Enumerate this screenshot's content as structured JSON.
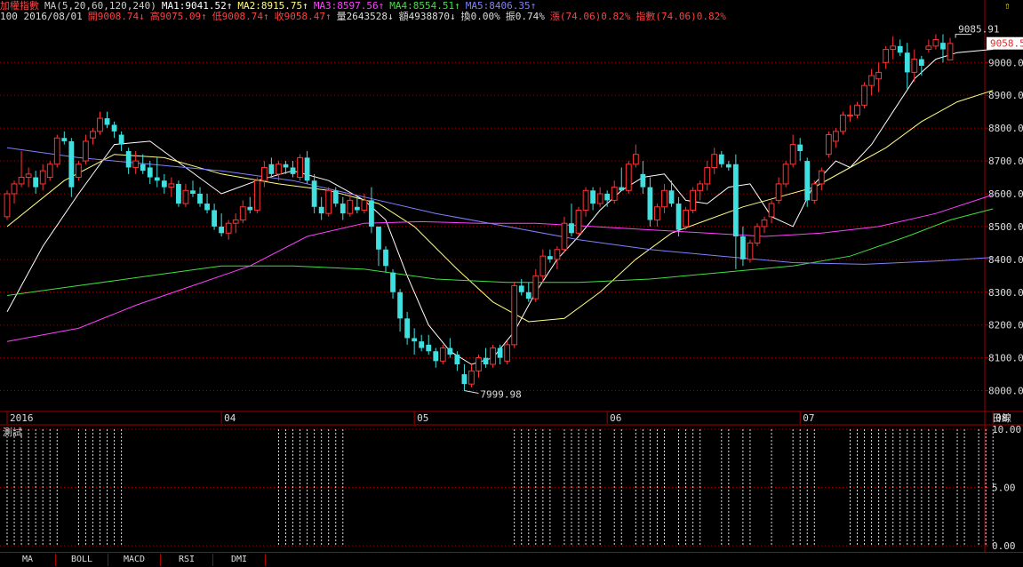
{
  "header": {
    "title": "加權指數",
    "ma_params": "MA(5,20,60,120,240)",
    "ma1": "MA1:9041.52↑",
    "ma2": "MA2:8915.75↑",
    "ma3": "MA3:8597.56↑",
    "ma4": "MA4:8554.51↑",
    "ma5": "MA5:8406.35↑",
    "info_prefix": "100 2016/08/01",
    "open": "開9008.74↓",
    "high": "高9075.09↑",
    "low": "低9008.74↑",
    "close": "收9058.47↑",
    "volume": "量2643528↓",
    "amount": "額4938870↓",
    "turnover": "換0.00%",
    "amplitude": "振0.74%",
    "change": "漲(74.06)0.82%",
    "index_change": "指數(74.06)0.82%"
  },
  "corner_icon": "up-arrow-icon",
  "colors": {
    "up": "#ff3333",
    "down": "#40e0e0",
    "ma1": "#ffffff",
    "ma2": "#ffff80",
    "ma3": "#ff40ff",
    "ma4": "#40e040",
    "ma5": "#8080ff",
    "grid": "#a00000",
    "price_tag": "#ff2020"
  },
  "chart_data": {
    "type": "candlestick",
    "ylim": [
      7950,
      9120
    ],
    "y_ticks": [
      "9000.0",
      "8900.0",
      "8800.0",
      "8700.0",
      "8600.0",
      "8500.0",
      "8400.0",
      "8300.0",
      "8200.0",
      "8100.0",
      "8000.0"
    ],
    "y_tick_values": [
      9000,
      8900,
      8800,
      8700,
      8600,
      8500,
      8400,
      8300,
      8200,
      8100,
      8000
    ],
    "x_labels": [
      {
        "label": "2016",
        "index": 0
      },
      {
        "label": "04",
        "index": 30
      },
      {
        "label": "05",
        "index": 57
      },
      {
        "label": "06",
        "index": 84
      },
      {
        "label": "07",
        "index": 111
      },
      {
        "label": "08",
        "index": 138
      }
    ],
    "date_axis_label": "日線",
    "last_price": "9058.5",
    "max_label": "9085.91",
    "max_index": 135,
    "max_value": 9085.91,
    "min_label": "7999.98",
    "min_index": 64,
    "min_value": 7999.98,
    "candles": [
      [
        8530,
        8610,
        8520,
        8600
      ],
      [
        8600,
        8640,
        8570,
        8630
      ],
      [
        8630,
        8730,
        8620,
        8650
      ],
      [
        8650,
        8680,
        8620,
        8660
      ],
      [
        8650,
        8670,
        8600,
        8620
      ],
      [
        8630,
        8690,
        8610,
        8670
      ],
      [
        8650,
        8700,
        8640,
        8690
      ],
      [
        8690,
        8780,
        8680,
        8770
      ],
      [
        8770,
        8790,
        8750,
        8760
      ],
      [
        8760,
        8770,
        8590,
        8620
      ],
      [
        8650,
        8700,
        8640,
        8690
      ],
      [
        8700,
        8780,
        8690,
        8760
      ],
      [
        8770,
        8800,
        8750,
        8790
      ],
      [
        8790,
        8850,
        8780,
        8830
      ],
      [
        8830,
        8850,
        8800,
        8810
      ],
      [
        8810,
        8820,
        8770,
        8790
      ],
      [
        8780,
        8790,
        8730,
        8750
      ],
      [
        8730,
        8740,
        8660,
        8680
      ],
      [
        8680,
        8730,
        8660,
        8700
      ],
      [
        8690,
        8720,
        8660,
        8670
      ],
      [
        8680,
        8700,
        8630,
        8650
      ],
      [
        8650,
        8710,
        8620,
        8640
      ],
      [
        8640,
        8660,
        8600,
        8620
      ],
      [
        8620,
        8650,
        8590,
        8630
      ],
      [
        8630,
        8640,
        8560,
        8570
      ],
      [
        8570,
        8630,
        8560,
        8610
      ],
      [
        8610,
        8640,
        8590,
        8600
      ],
      [
        8600,
        8620,
        8560,
        8570
      ],
      [
        8570,
        8600,
        8540,
        8550
      ],
      [
        8550,
        8570,
        8490,
        8500
      ],
      [
        8500,
        8540,
        8470,
        8480
      ],
      [
        8480,
        8520,
        8460,
        8510
      ],
      [
        8510,
        8540,
        8480,
        8520
      ],
      [
        8520,
        8580,
        8510,
        8560
      ],
      [
        8560,
        8590,
        8540,
        8550
      ],
      [
        8550,
        8650,
        8540,
        8640
      ],
      [
        8640,
        8700,
        8620,
        8680
      ],
      [
        8690,
        8710,
        8650,
        8660
      ],
      [
        8660,
        8700,
        8640,
        8690
      ],
      [
        8690,
        8700,
        8660,
        8680
      ],
      [
        8680,
        8700,
        8650,
        8660
      ],
      [
        8650,
        8720,
        8640,
        8710
      ],
      [
        8710,
        8730,
        8630,
        8640
      ],
      [
        8640,
        8660,
        8540,
        8560
      ],
      [
        8560,
        8590,
        8520,
        8540
      ],
      [
        8540,
        8620,
        8530,
        8610
      ],
      [
        8610,
        8620,
        8560,
        8570
      ],
      [
        8570,
        8590,
        8520,
        8540
      ],
      [
        8540,
        8600,
        8530,
        8580
      ],
      [
        8560,
        8590,
        8540,
        8550
      ],
      [
        8550,
        8600,
        8540,
        8580
      ],
      [
        8580,
        8620,
        8480,
        8500
      ],
      [
        8500,
        8480,
        8380,
        8430
      ],
      [
        8430,
        8440,
        8360,
        8380
      ],
      [
        8360,
        8370,
        8280,
        8300
      ],
      [
        8300,
        8310,
        8180,
        8220
      ],
      [
        8220,
        8240,
        8140,
        8160
      ],
      [
        8160,
        8190,
        8110,
        8150
      ],
      [
        8150,
        8170,
        8120,
        8130
      ],
      [
        8140,
        8170,
        8110,
        8120
      ],
      [
        8120,
        8130,
        8070,
        8090
      ],
      [
        8090,
        8140,
        8080,
        8130
      ],
      [
        8130,
        8160,
        8100,
        8110
      ],
      [
        8110,
        8120,
        8060,
        8080
      ],
      [
        8050,
        8080,
        8000,
        8020
      ],
      [
        8020,
        8080,
        8010,
        8060
      ],
      [
        8060,
        8110,
        8040,
        8100
      ],
      [
        8100,
        8130,
        8070,
        8080
      ],
      [
        8080,
        8140,
        8070,
        8130
      ],
      [
        8130,
        8140,
        8080,
        8100
      ],
      [
        8090,
        8150,
        8080,
        8140
      ],
      [
        8140,
        8330,
        8130,
        8320
      ],
      [
        8320,
        8340,
        8290,
        8300
      ],
      [
        8300,
        8330,
        8270,
        8280
      ],
      [
        8280,
        8370,
        8270,
        8350
      ],
      [
        8350,
        8430,
        8330,
        8410
      ],
      [
        8410,
        8430,
        8390,
        8400
      ],
      [
        8400,
        8440,
        8370,
        8430
      ],
      [
        8430,
        8530,
        8420,
        8510
      ],
      [
        8510,
        8570,
        8470,
        8480
      ],
      [
        8480,
        8560,
        8470,
        8550
      ],
      [
        8550,
        8620,
        8530,
        8610
      ],
      [
        8610,
        8620,
        8550,
        8570
      ],
      [
        8570,
        8620,
        8560,
        8600
      ],
      [
        8600,
        8610,
        8560,
        8580
      ],
      [
        8580,
        8640,
        8570,
        8620
      ],
      [
        8620,
        8680,
        8610,
        8610
      ],
      [
        8610,
        8700,
        8600,
        8690
      ],
      [
        8690,
        8750,
        8680,
        8720
      ],
      [
        8660,
        8700,
        8600,
        8620
      ],
      [
        8620,
        8650,
        8500,
        8520
      ],
      [
        8520,
        8570,
        8500,
        8560
      ],
      [
        8560,
        8630,
        8540,
        8610
      ],
      [
        8610,
        8640,
        8560,
        8570
      ],
      [
        8570,
        8590,
        8470,
        8490
      ],
      [
        8500,
        8560,
        8490,
        8550
      ],
      [
        8550,
        8620,
        8540,
        8610
      ],
      [
        8610,
        8640,
        8580,
        8630
      ],
      [
        8630,
        8700,
        8610,
        8680
      ],
      [
        8680,
        8740,
        8660,
        8720
      ],
      [
        8720,
        8730,
        8680,
        8690
      ],
      [
        8690,
        8700,
        8670,
        8680
      ],
      [
        8690,
        8720,
        8370,
        8470
      ],
      [
        8470,
        8500,
        8380,
        8400
      ],
      [
        8400,
        8460,
        8390,
        8450
      ],
      [
        8450,
        8510,
        8440,
        8500
      ],
      [
        8500,
        8530,
        8480,
        8520
      ],
      [
        8530,
        8580,
        8510,
        8570
      ],
      [
        8580,
        8650,
        8570,
        8630
      ],
      [
        8630,
        8700,
        8620,
        8690
      ],
      [
        8690,
        8780,
        8680,
        8750
      ],
      [
        8750,
        8770,
        8700,
        8730
      ],
      [
        8700,
        8710,
        8560,
        8580
      ],
      [
        8580,
        8640,
        8570,
        8630
      ],
      [
        8630,
        8680,
        8610,
        8670
      ],
      [
        8720,
        8790,
        8710,
        8780
      ],
      [
        8760,
        8800,
        8740,
        8790
      ],
      [
        8790,
        8850,
        8780,
        8840
      ],
      [
        8840,
        8870,
        8820,
        8840
      ],
      [
        8840,
        8880,
        8830,
        8870
      ],
      [
        8870,
        8940,
        8860,
        8930
      ],
      [
        8930,
        8980,
        8900,
        8960
      ],
      [
        8950,
        9000,
        8910,
        8970
      ],
      [
        9000,
        9050,
        8980,
        9040
      ],
      [
        9040,
        9080,
        9010,
        9050
      ],
      [
        9050,
        9070,
        9020,
        9030
      ],
      [
        9030,
        9060,
        8920,
        8970
      ],
      [
        8970,
        9040,
        8940,
        9010
      ],
      [
        9010,
        9020,
        8960,
        8990
      ],
      [
        9040,
        9070,
        9030,
        9050
      ],
      [
        9050,
        9086,
        9040,
        9070
      ],
      [
        9060,
        9086,
        9000,
        9040
      ],
      [
        9008,
        9075,
        9008,
        9058
      ]
    ],
    "ma_series": [
      {
        "name": "MA1",
        "color": "#ffffff",
        "values": [
          [
            0,
            8240
          ],
          [
            5,
            8440
          ],
          [
            10,
            8600
          ],
          [
            15,
            8750
          ],
          [
            20,
            8760
          ],
          [
            25,
            8680
          ],
          [
            30,
            8600
          ],
          [
            35,
            8640
          ],
          [
            40,
            8670
          ],
          [
            45,
            8640
          ],
          [
            50,
            8580
          ],
          [
            53,
            8520
          ],
          [
            56,
            8350
          ],
          [
            59,
            8200
          ],
          [
            62,
            8120
          ],
          [
            65,
            8080
          ],
          [
            68,
            8100
          ],
          [
            71,
            8180
          ],
          [
            74,
            8300
          ],
          [
            77,
            8400
          ],
          [
            80,
            8470
          ],
          [
            83,
            8550
          ],
          [
            86,
            8610
          ],
          [
            89,
            8650
          ],
          [
            92,
            8660
          ],
          [
            95,
            8580
          ],
          [
            98,
            8570
          ],
          [
            101,
            8620
          ],
          [
            104,
            8630
          ],
          [
            107,
            8530
          ],
          [
            110,
            8500
          ],
          [
            113,
            8630
          ],
          [
            116,
            8700
          ],
          [
            118,
            8680
          ],
          [
            121,
            8750
          ],
          [
            124,
            8850
          ],
          [
            127,
            8950
          ],
          [
            130,
            9010
          ],
          [
            133,
            9030
          ],
          [
            138,
            9040
          ]
        ]
      },
      {
        "name": "MA2",
        "color": "#ffff80",
        "values": [
          [
            0,
            8500
          ],
          [
            8,
            8640
          ],
          [
            15,
            8720
          ],
          [
            22,
            8710
          ],
          [
            30,
            8660
          ],
          [
            38,
            8630
          ],
          [
            45,
            8610
          ],
          [
            52,
            8570
          ],
          [
            57,
            8500
          ],
          [
            63,
            8370
          ],
          [
            68,
            8270
          ],
          [
            73,
            8210
          ],
          [
            78,
            8220
          ],
          [
            83,
            8300
          ],
          [
            88,
            8400
          ],
          [
            93,
            8480
          ],
          [
            98,
            8520
          ],
          [
            103,
            8560
          ],
          [
            108,
            8590
          ],
          [
            113,
            8620
          ],
          [
            118,
            8680
          ],
          [
            123,
            8740
          ],
          [
            128,
            8820
          ],
          [
            133,
            8880
          ],
          [
            138,
            8915
          ]
        ]
      },
      {
        "name": "MA3",
        "color": "#ff40ff",
        "values": [
          [
            0,
            8150
          ],
          [
            10,
            8190
          ],
          [
            18,
            8260
          ],
          [
            26,
            8320
          ],
          [
            34,
            8380
          ],
          [
            42,
            8470
          ],
          [
            50,
            8510
          ],
          [
            58,
            8515
          ],
          [
            66,
            8510
          ],
          [
            74,
            8510
          ],
          [
            82,
            8500
          ],
          [
            90,
            8490
          ],
          [
            98,
            8480
          ],
          [
            106,
            8470
          ],
          [
            114,
            8480
          ],
          [
            122,
            8500
          ],
          [
            130,
            8540
          ],
          [
            138,
            8597
          ]
        ]
      },
      {
        "name": "MA4",
        "color": "#40e040",
        "values": [
          [
            0,
            8290
          ],
          [
            10,
            8320
          ],
          [
            20,
            8350
          ],
          [
            30,
            8380
          ],
          [
            40,
            8380
          ],
          [
            50,
            8370
          ],
          [
            60,
            8340
          ],
          [
            70,
            8330
          ],
          [
            80,
            8330
          ],
          [
            90,
            8340
          ],
          [
            100,
            8360
          ],
          [
            110,
            8380
          ],
          [
            118,
            8410
          ],
          [
            126,
            8470
          ],
          [
            132,
            8520
          ],
          [
            138,
            8554
          ]
        ]
      },
      {
        "name": "MA5",
        "color": "#8080ff",
        "values": [
          [
            0,
            8740
          ],
          [
            10,
            8710
          ],
          [
            20,
            8690
          ],
          [
            30,
            8670
          ],
          [
            40,
            8640
          ],
          [
            50,
            8590
          ],
          [
            60,
            8540
          ],
          [
            70,
            8500
          ],
          [
            80,
            8460
          ],
          [
            90,
            8430
          ],
          [
            100,
            8410
          ],
          [
            110,
            8390
          ],
          [
            120,
            8385
          ],
          [
            130,
            8395
          ],
          [
            138,
            8406
          ]
        ]
      }
    ]
  },
  "sub_panel": {
    "label": "測試",
    "y_ticks": [
      "10.00",
      "5.00",
      "0.00"
    ],
    "y_tick_values": [
      10,
      5,
      0
    ],
    "bar_indices": [
      0,
      1,
      2,
      3,
      4,
      5,
      6,
      7,
      10,
      11,
      12,
      13,
      14,
      15,
      16,
      38,
      39,
      40,
      41,
      42,
      43,
      44,
      45,
      46,
      47,
      71,
      72,
      73,
      74,
      75,
      76,
      78,
      79,
      80,
      81,
      82,
      83,
      85,
      86,
      88,
      89,
      90,
      91,
      92,
      94,
      95,
      96,
      97,
      100,
      101,
      103,
      104,
      107,
      110,
      111,
      112,
      113,
      118,
      119,
      120,
      121,
      122,
      123,
      124,
      125,
      126,
      127,
      128,
      129,
      130,
      131,
      133,
      134,
      136,
      137,
      138
    ]
  },
  "tabs": [
    "MA",
    "BOLL",
    "MACD",
    "RSI",
    "DMI"
  ]
}
